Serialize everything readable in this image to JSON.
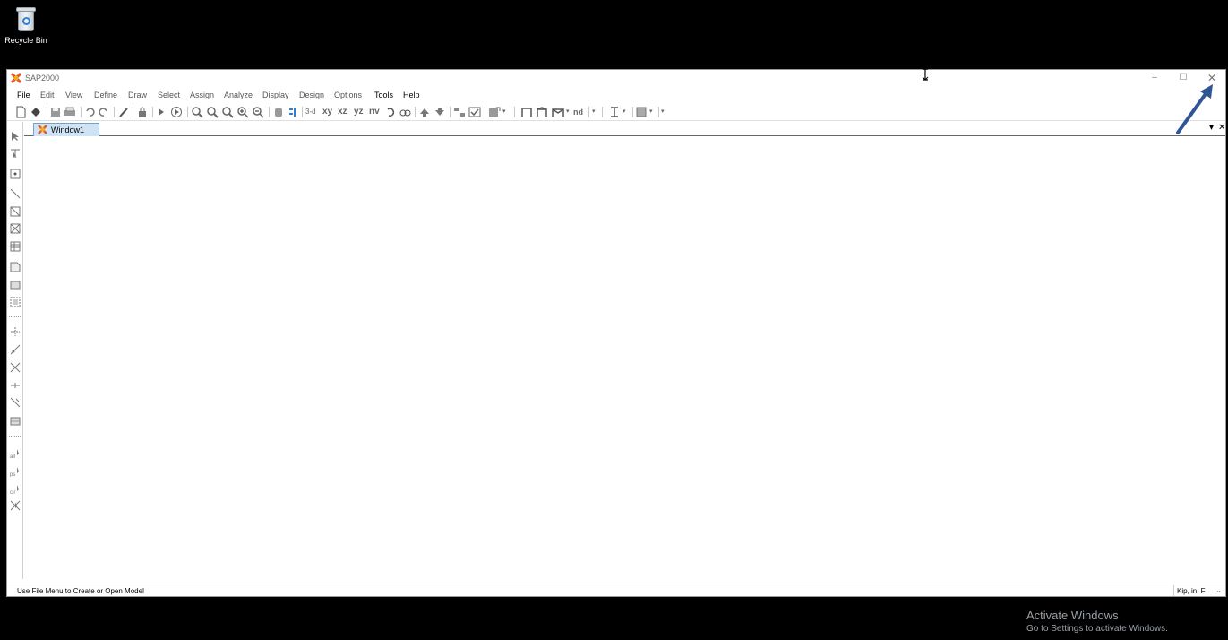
{
  "desktop": {
    "recycle_bin_label": "Recycle Bin"
  },
  "window": {
    "title": "SAP2000",
    "min_glyph": "–",
    "max_glyph": "☐",
    "close_glyph": "✕"
  },
  "menu": {
    "items": [
      "File",
      "Edit",
      "View",
      "Define",
      "Draw",
      "Select",
      "Assign",
      "Analyze",
      "Display",
      "Design",
      "Options",
      "Tools",
      "Help"
    ]
  },
  "toolbar": {
    "view_3d": "3-d",
    "view_xy": "xy",
    "view_xz": "xz",
    "view_yz": "yz",
    "view_nv": "nv",
    "nd_label": "nd"
  },
  "tabs": {
    "active_label": "Window1",
    "dropdown_glyph": "▾",
    "close_glyph": "✕"
  },
  "status": {
    "message": "Use File Menu to Create or Open Model",
    "units": "Kip, in, F"
  },
  "watermark": {
    "line1": "Activate Windows",
    "line2": "Go to Settings to activate Windows."
  },
  "colors": {
    "accent_tab": "#cfe3f7",
    "annotation_arrow": "#2f5597",
    "app_icon": "#e8552a"
  }
}
